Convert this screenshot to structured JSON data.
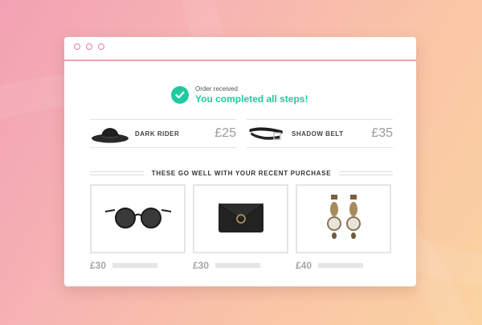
{
  "status": {
    "subtitle": "Order received",
    "title": "You completed all steps!",
    "accent_color": "#1fcaa1"
  },
  "purchases": [
    {
      "name": "DARK RIDER",
      "price": "£25",
      "icon": "hat-icon"
    },
    {
      "name": "SHADOW BELT",
      "price": "£35",
      "icon": "belt-icon"
    }
  ],
  "recommendations": {
    "title": "THESE GO WELL WITH YOUR RECENT PURCHASE",
    "items": [
      {
        "price": "£30",
        "icon": "sunglasses-icon"
      },
      {
        "price": "£30",
        "icon": "wallet-icon"
      },
      {
        "price": "£40",
        "icon": "earrings-icon"
      }
    ]
  }
}
